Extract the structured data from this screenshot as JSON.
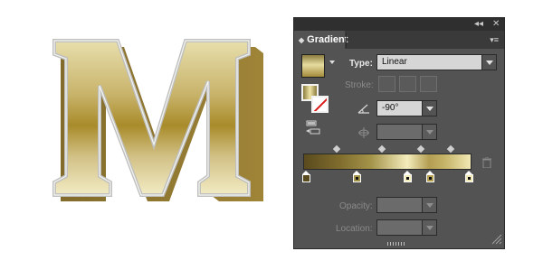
{
  "artwork": {
    "letter": "M"
  },
  "panel": {
    "title": "Gradient",
    "top_controls": {
      "collapse": "◂◂",
      "close": "✕"
    },
    "menu_icon": "panel-menu-icon",
    "type": {
      "label": "Type:",
      "value": "Linear"
    },
    "stroke": {
      "label": "Stroke:"
    },
    "angle": {
      "value": "-90°"
    },
    "aspect_ratio": {
      "value": ""
    },
    "opacity": {
      "label": "Opacity:",
      "value": ""
    },
    "location": {
      "label": "Location:",
      "value": ""
    },
    "gradient_colors": [
      "#5a4b1e",
      "#7d6a2c",
      "#a39349",
      "#f4ecbc",
      "#b39e52",
      "#c6b56a",
      "#f1e8b4"
    ],
    "color_stop_count": 5,
    "midpoint_count": 4
  }
}
